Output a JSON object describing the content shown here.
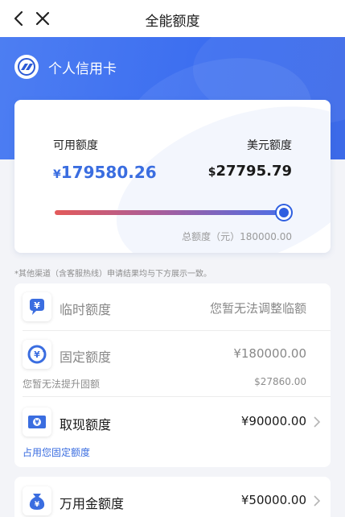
{
  "nav": {
    "title": "全能额度"
  },
  "card": {
    "name": "个人信用卡"
  },
  "limits": {
    "available_label": "可用额度",
    "available_currency": "¥",
    "available_value": "179580.26",
    "usd_label": "美元额度",
    "usd_currency": "$",
    "usd_value": "27795.79",
    "available_fraction": 0.9977,
    "total_text": "总额度（元）180000.00"
  },
  "note": "*其他渠道（含客服热线）申请结果均与下方展示一致。",
  "items": [
    {
      "label": "临时额度",
      "value": "您暂无法调整临额"
    },
    {
      "label": "固定额度",
      "value": "¥180000.00",
      "sub_left": "您暂无法提升固额",
      "sub_right": "$27860.00"
    },
    {
      "label": "取现额度",
      "value": "¥90000.00",
      "sub_left": "占用您固定额度"
    },
    {
      "label": "万用金额度",
      "value": "¥50000.00"
    }
  ],
  "colors": {
    "accent": "#3b6df0",
    "amount_blue": "#3a6de0",
    "disabled_text": "#888888",
    "link_blue": "#3a6de0"
  },
  "icons": [
    "back-arrow-icon",
    "close-icon",
    "bank-logo-icon",
    "temporary-limit-icon",
    "fixed-limit-icon",
    "cash-limit-icon",
    "wanyongjin-limit-icon",
    "chevron-right-icon"
  ]
}
